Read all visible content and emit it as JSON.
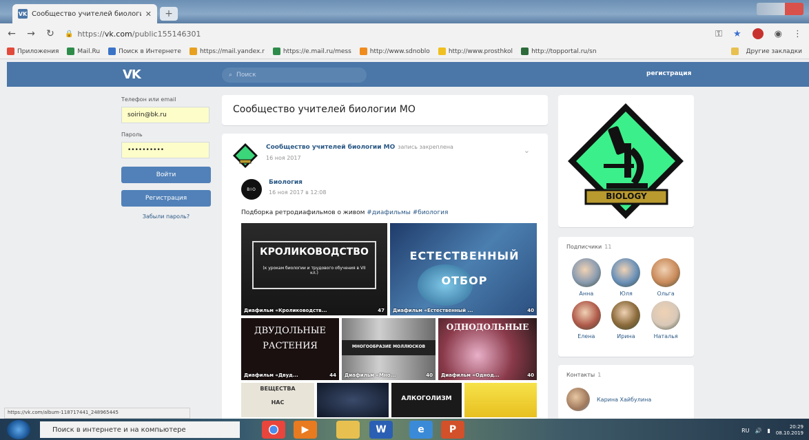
{
  "browser": {
    "tab_title": "Сообщество учителей биологи",
    "tab_favicon": "vk-favicon-icon",
    "url_prefix": "https://",
    "url_domain": "vk.com",
    "url_path": "/public155146301",
    "bookmarks": [
      {
        "label": "Приложения",
        "color": "#e24a3b"
      },
      {
        "label": "Mail.Ru",
        "color": "#2d8c4a"
      },
      {
        "label": "Поиск в Интернете",
        "color": "#3b73c7"
      },
      {
        "label": "https://mail.yandex.r",
        "color": "#e8a020"
      },
      {
        "label": "https://e.mail.ru/mess",
        "color": "#2d8c4a"
      },
      {
        "label": "http://www.sdnoblo",
        "color": "#f08b1d"
      },
      {
        "label": "http://www.prosthkol",
        "color": "#f0c020"
      },
      {
        "label": "http://topportal.ru/sn",
        "color": "#2d6c3a"
      }
    ],
    "bookmarks_other": "Другие закладки",
    "status_url": "https://vk.com/album-118717441_248965445"
  },
  "vk": {
    "logo": "VK",
    "search_placeholder": "Поиск",
    "register_link": "регистрация",
    "brand_color": "#4a76a8"
  },
  "login": {
    "phone_label": "Телефон или email",
    "phone_value": "soirin@bk.ru",
    "password_label": "Пароль",
    "password_value": "••••••••••",
    "login_button": "Войти",
    "register_button": "Регистрация",
    "forgot_link": "Забыли пароль?"
  },
  "page": {
    "title": "Сообщество учителей биологии МО"
  },
  "post": {
    "author": "Сообщество учителей биологии МО",
    "pinned": "запись закреплена",
    "date": "16 ноя 2017",
    "repost_author": "Биология",
    "repost_date": "16 ноя 2017 в 12:08",
    "repost_avatar_text": "BIO",
    "text": "Подборка ретродиафильмов о живом",
    "tags": "#диафильмы #биология",
    "tiles": [
      {
        "big": "КРОЛИКОВОДСТВО",
        "sub": "(к урокам биологии и трудового обучения в VII кл.)",
        "caption": "Диафильм «Кролиководств...",
        "count": "47"
      },
      {
        "big": "ЕСТЕСТВЕННЫЙ ОТБОР",
        "caption": "Диафильм «Естественный ...",
        "count": "40"
      },
      {
        "big": "ДВУДОЛЬНЫЕ РАСТЕНИЯ",
        "caption": "Диафильм «Двуд...",
        "count": "44"
      },
      {
        "big": "МНОГООБРАЗИЕ МОЛЛЮСКОВ",
        "caption": "Диафильм «Мно...",
        "count": "40"
      },
      {
        "big": "ОДНОДОЛЬНЫЕ",
        "caption": "Диафильм «Однод...",
        "count": "40"
      },
      {
        "big": "ВЕЩЕСТВА",
        "sub": "НАС"
      },
      {
        "big": "АЛКОГОЛИЗМ"
      }
    ]
  },
  "sidebar": {
    "logo_text": "BIOLOGY",
    "subscribers_label": "Подписчики",
    "subscribers_count": "11",
    "subscribers": [
      {
        "name": "Анна",
        "color": "#8a9bb0"
      },
      {
        "name": "Юля",
        "color": "#6a90b8"
      },
      {
        "name": "Ольга",
        "color": "#c98a5a"
      },
      {
        "name": "Елена",
        "color": "#b05a4a"
      },
      {
        "name": "Ирина",
        "color": "#8a6a3a"
      },
      {
        "name": "Наталья",
        "color": "#d8c8b8"
      }
    ],
    "contacts_label": "Контакты",
    "contacts_count": "1",
    "contact_name": "Карина Хайбулина"
  },
  "taskbar": {
    "search_placeholder": "Поиск в интернете и на компьютере",
    "lang": "RU",
    "time": "20:29",
    "date": "08.10.2019"
  }
}
